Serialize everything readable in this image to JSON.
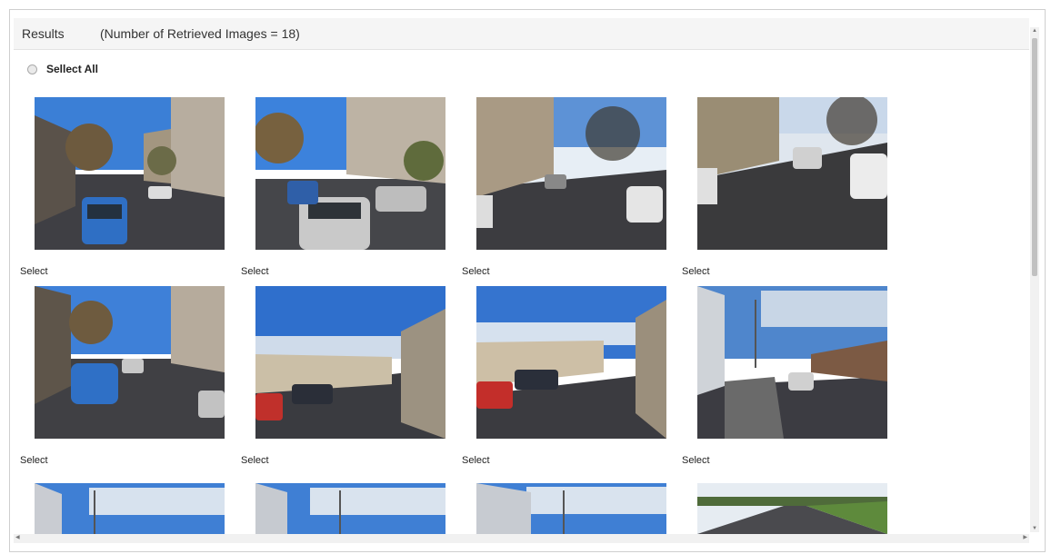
{
  "results": {
    "title": "Results",
    "count_text": "(Number of Retrieved Images = 18)"
  },
  "select_all_label": "Sellect All",
  "select_labels": [
    "Select",
    "Select",
    "Select",
    "Select",
    "Select",
    "Select",
    "Select",
    "Select"
  ],
  "colors": {
    "sky": "#3d7fd9",
    "road": "#3f3f45",
    "building": "#b8ab98",
    "car_blue": "#2f6fc4",
    "tree": "#6f5c3f"
  }
}
